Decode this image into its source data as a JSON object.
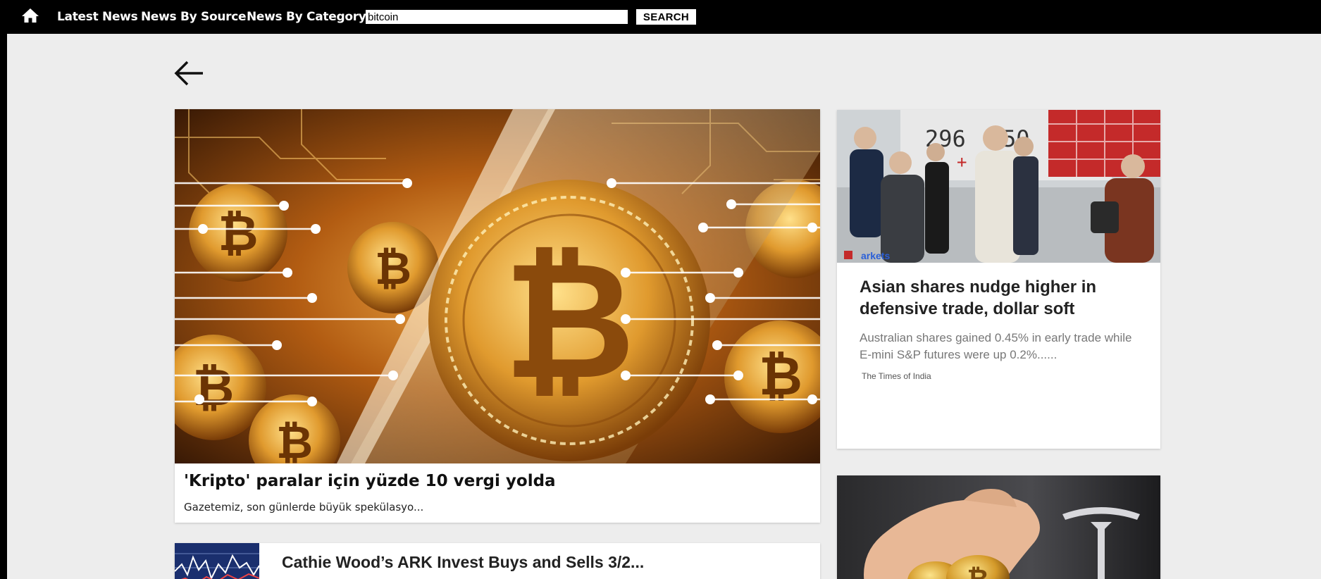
{
  "nav": {
    "home_icon": "home-icon",
    "links": [
      "Latest News",
      "News By Source",
      "News By Category"
    ],
    "search_value": "bitcoin",
    "search_button": "SEARCH"
  },
  "back_icon": "arrow-left-icon",
  "featured": {
    "title": "'Kripto' paralar için yüzde 10 vergi yolda",
    "description": "Gazetemiz, son günlerde büyük spekülasyo..."
  },
  "side_article": {
    "title": "Asian shares nudge higher in defensive trade, dollar soft",
    "description": "Australian shares gained 0.45% in early trade while E-mini S&P futures were up 0.2%......",
    "source": "The Times of India"
  },
  "list_article": {
    "title": "Cathie Wood’s ARK Invest Buys and Sells 3/2..."
  },
  "colors": {
    "nav_bg": "#000000",
    "page_bg": "#ededed",
    "card_bg": "#ffffff"
  }
}
